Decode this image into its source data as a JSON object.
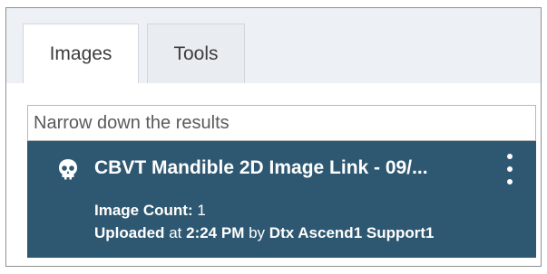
{
  "tabs": [
    {
      "label": "Images",
      "active": true
    },
    {
      "label": "Tools",
      "active": false
    }
  ],
  "search": {
    "placeholder": "Narrow down the results",
    "value": ""
  },
  "result": {
    "icon": "skull-icon",
    "title": "CBVT Mandible 2D Image Link - 09/...",
    "count_label": "Image Count:",
    "count_value": "1",
    "uploaded_label": "Uploaded",
    "uploaded_at_word": "at",
    "uploaded_time": "2:24 PM",
    "uploaded_by_word": "by",
    "uploaded_by": "Dtx Ascend1 Support1",
    "menu_icon": "kebab-menu-icon"
  },
  "colors": {
    "card_background": "#2e5871",
    "tabbar_background": "#edf1f5"
  }
}
